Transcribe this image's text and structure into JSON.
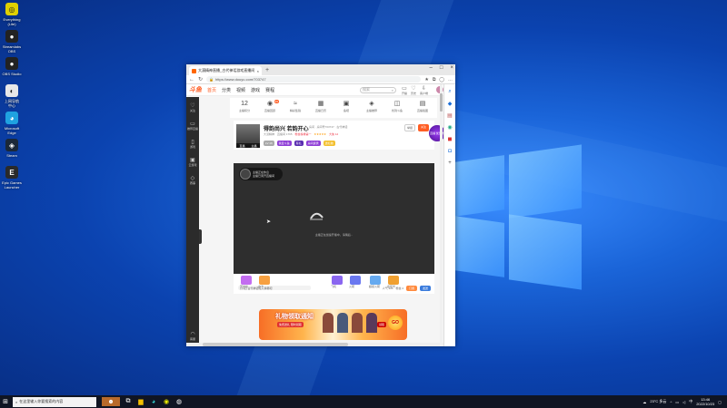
{
  "desktop_icons": [
    {
      "label": "Everything\n(Lite)",
      "color": "#e0d000",
      "glyph": "search-icon"
    },
    {
      "label": "Streamlabs\nOBS",
      "color": "#222",
      "glyph": "obs-icon"
    },
    {
      "label": "OBS Studio",
      "color": "#222",
      "glyph": "obs-icon"
    },
    {
      "label": "上网导航\n中心",
      "color": "#e8e8e8",
      "glyph": "browser-icon"
    },
    {
      "label": "Microsoft\nEdge",
      "color": "#1fa2e0",
      "glyph": "edge-icon"
    },
    {
      "label": "Steam",
      "color": "#1b2838",
      "glyph": "steam-icon"
    },
    {
      "label": "Epic Games\nLauncher",
      "color": "#2a2a2a",
      "glyph": "epic-icon"
    }
  ],
  "browser": {
    "tab_title": "大漠精神直播_古代神话游戏直播间",
    "url": "https://www.douyu.com/703747",
    "sidebar_icons": [
      "search-icon",
      "shopping-icon",
      "briefcase-icon",
      "game-icon",
      "office-icon",
      "outlook-icon",
      "add-icon"
    ]
  },
  "site": {
    "logo": "斗鱼",
    "nav": [
      "首页",
      "分类",
      "视频",
      "游戏",
      "赛程"
    ],
    "search_placeholder": "搜索",
    "header_icons": [
      "开播",
      "历史",
      "客户端"
    ],
    "left_menu": [
      "关注",
      "推荐直播",
      "游戏",
      "云游戏",
      "赛事"
    ],
    "left_bottom": "客服",
    "quick": [
      {
        "label": "主播积分",
        "glyph": "12",
        "badge": ""
      },
      {
        "label": "直播回顾",
        "glyph": "◉",
        "badge": "99"
      },
      {
        "label": "精彩集锦",
        "glyph": "≈",
        "badge": ""
      },
      {
        "label": "直播日历",
        "glyph": "▦",
        "badge": ""
      },
      {
        "label": "鱼吧",
        "glyph": "▣",
        "badge": ""
      },
      {
        "label": "主播推荐",
        "glyph": "◈",
        "badge": ""
      },
      {
        "label": "找到斗鱼",
        "glyph": "◫",
        "badge": ""
      },
      {
        "label": "直播截图",
        "glyph": "▤",
        "badge": ""
      }
    ],
    "room": {
      "title": "得韵尚兴 若韵开心",
      "meta": "房间 · 房间号703747 · 古代神话",
      "level_left": "直播",
      "level_right": "主播",
      "row2": [
        "大漠精神",
        "直播间 1765",
        "粉丝榜排第一",
        "★★★★★",
        "大侠 12"
      ],
      "tags": [
        {
          "text": "LV 16",
          "color": "#aaa"
        },
        {
          "text": "我爱斗鱼",
          "color": "#8e3dd6"
        },
        {
          "text": "有礼",
          "color": "#5a2db0"
        },
        {
          "text": "房间贵宾",
          "color": "#8e3dd6"
        },
        {
          "text": "送礼物",
          "color": "#f4c030"
        }
      ],
      "report": "举报",
      "follow": "关注",
      "promo": "直播\n优惠券"
    },
    "player": {
      "badge_line1": "主播正在休息",
      "badge_line2": "主播已离开直播间",
      "message": "主播正在加速开播中，请稍后..."
    },
    "giftbar": {
      "gifts": [
        "荧光棒",
        "办卡",
        "飞机",
        "火箭",
        "超级火箭",
        "嘉年华"
      ],
      "danmu_placeholder": "[小花] 古代神话轮入弹幕吧",
      "count_label": "人气 106",
      "fans_label": "粉丝 4",
      "btn1": "订阅",
      "btn2": "发送"
    },
    "ad": {
      "title": "礼物领取通知",
      "sub": "免费送礼 限时领取",
      "sign": "领取",
      "go": "GO"
    }
  },
  "taskbar": {
    "search_placeholder": "在这里输入你要搜索的内容",
    "weather": "23°C 多云",
    "time": "13:46",
    "date": "2022/10/23",
    "lang": "中"
  }
}
